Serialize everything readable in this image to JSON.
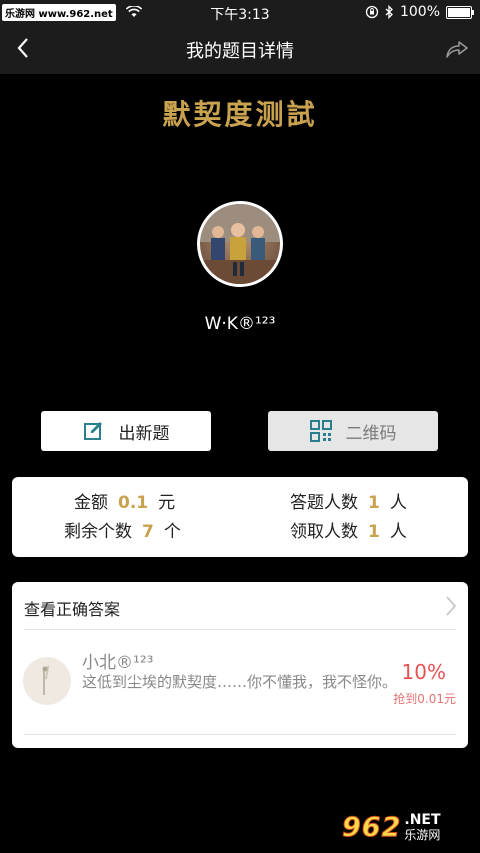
{
  "status_bar": {
    "watermark": "乐游网 www.962.net",
    "time": "下午3:13",
    "battery": "100%"
  },
  "nav": {
    "title": "我的题目详情"
  },
  "header": {
    "title": "默契度测試"
  },
  "user": {
    "name": "W·K®¹²³"
  },
  "actions": {
    "new_question": "出新题",
    "qr_code": "二维码"
  },
  "stats": {
    "amount_label": "金额",
    "amount_value": "0.1",
    "amount_unit": "元",
    "answered_label": "答题人数",
    "answered_value": "1",
    "answered_unit": "人",
    "remaining_label": "剩余个数",
    "remaining_value": "7",
    "remaining_unit": "个",
    "claimed_label": "领取人数",
    "claimed_value": "1",
    "claimed_unit": "人"
  },
  "answers": {
    "header": "查看正确答案",
    "items": [
      {
        "name": "小北®¹²³",
        "message": "这低到尘埃的默契度……你不懂我，我不怪你。",
        "percent": "10%",
        "amount": "抢到0.01元"
      }
    ]
  },
  "watermark_logo": {
    "number": "962",
    "net": ".NET",
    "cn": "乐游网"
  },
  "colors": {
    "gold": "#c9a24f",
    "red": "#e55353",
    "teal": "#2a7f8f"
  }
}
